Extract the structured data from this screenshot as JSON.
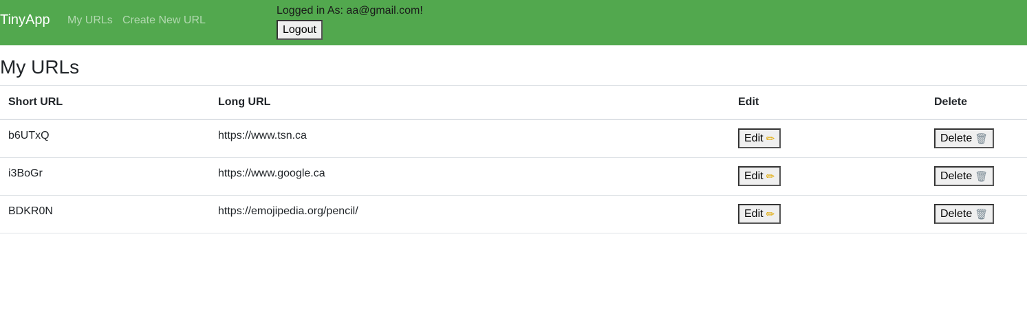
{
  "navbar": {
    "brand": "TinyApp",
    "links": [
      "My URLs",
      "Create New URL"
    ],
    "logged_in_text": "Logged in As: aa@gmail.com!",
    "logout_label": "Logout",
    "background_color": "#52a84e"
  },
  "page": {
    "title": "My URLs"
  },
  "table": {
    "headers": [
      "Short URL",
      "Long URL",
      "Edit",
      "Delete"
    ],
    "rows": [
      {
        "short": "b6UTxQ",
        "long": "https://www.tsn.ca"
      },
      {
        "short": "i3BoGr",
        "long": "https://www.google.ca"
      },
      {
        "short": "BDKR0N",
        "long": "https://emojipedia.org/pencil/"
      }
    ],
    "edit_label": "Edit",
    "delete_label": "Delete",
    "edit_icon": "pencil-icon",
    "delete_icon": "wastebasket-icon"
  }
}
